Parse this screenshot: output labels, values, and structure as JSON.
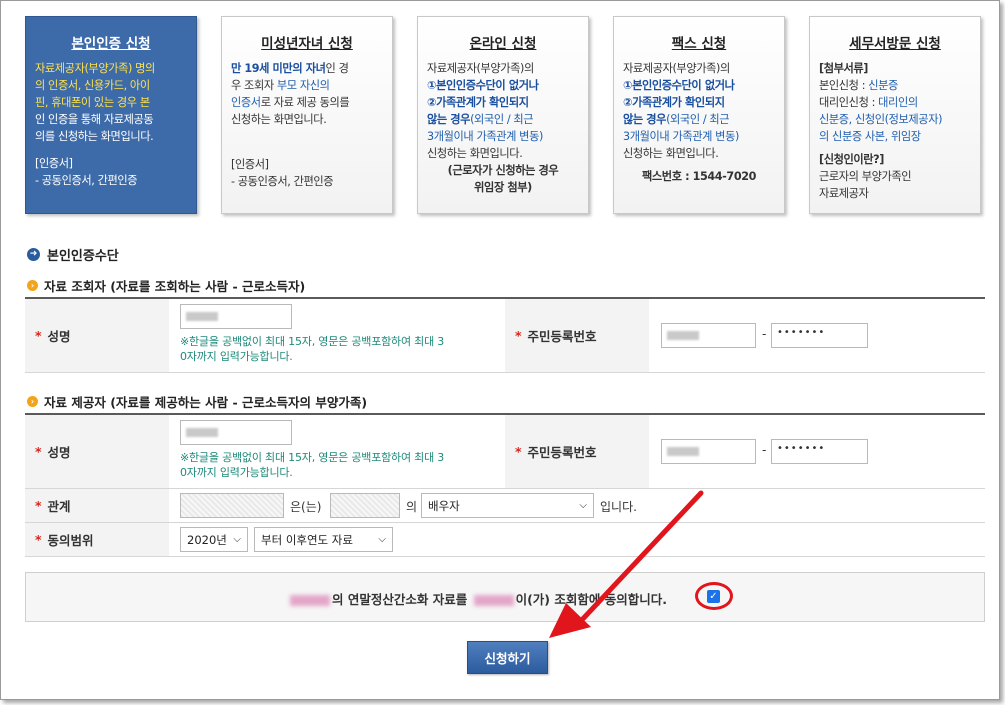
{
  "cards": [
    {
      "title": "본인인증 신청",
      "l1": "자료제공자(부양가족) 명의",
      "l2": "의 인증서, 신용카드, 아이",
      "l3": "핀,  휴대폰이 있는 경우 본",
      "l4": "인 인증을 통해 자료제공동",
      "l5": "의를 신청하는 화면입니다.",
      "cert_head": "[인증서]",
      "cert_body": "- 공동인증서, 간편인증"
    },
    {
      "title": "미성년자녀 신청",
      "l1a": "만 19세 미만의 자녀",
      "l1b": "인 경",
      "l2a": "우 조회자 ",
      "l2b": "부모 자신의",
      "l3a": "인증서",
      "l3b": "로 자료 제공 동의를",
      "l4": "신청하는 화면입니다.",
      "cert_head": "[인증서]",
      "cert_body": "- 공동인증서, 간편인증"
    },
    {
      "title": "온라인 신청",
      "l1": "자료제공자(부양가족)의",
      "l2": "①본인인증수단이 없거나",
      "l3": "②가족관계가 확인되지",
      "l4a": "않는 경우",
      "l4b": "(외국인 / 최근",
      "l5": "3개월이내 가족관계 변동)",
      "l6": "신청하는 화면입니다.",
      "l7": "(근로자가 신청하는 경우",
      "l8": "위임장 첨부)"
    },
    {
      "title": "팩스 신청",
      "l1": "자료제공자(부양가족)의",
      "l2": "①본인인증수단이 없거나",
      "l3": "②가족관계가 확인되지",
      "l4a": "않는 경우",
      "l4b": "(외국인 / 최근",
      "l5": "3개월이내 가족관계 변동)",
      "l6": "신청하는 화면입니다.",
      "fax": "팩스번호 : 1544-7020"
    },
    {
      "title": "세무서방문 신청",
      "docs_head": "[첨부서류]",
      "l1a": "본인신청 : ",
      "l1b": "신분증",
      "l2a": "대리인신청 : ",
      "l2b": "대리인의",
      "l3": "신분증, 신청인(정보제공자)",
      "l4": "의 신분증 사본, 위임장",
      "who_head": "[신청인이란?]",
      "l5": "근로자의 부양가족인",
      "l6": "자료제공자"
    }
  ],
  "section_main": "본인인증수단",
  "viewer_section": "자료 조회자 (자료를 조회하는 사람 - 근로소득자)",
  "provider_section": "자료 제공자 (자료를 제공하는 사람 - 근로소득자의 부양가족)",
  "labels": {
    "name": "성명",
    "rrn": "주민등록번호",
    "relation": "관계",
    "scope": "동의범위"
  },
  "note_line1": "※한글을 공백없이 최대 15자, 영문은 공백포함하여 최대 3",
  "note_line2": "0자까지 입력가능합니다.",
  "viewer": {
    "rrn_back": "•••••••"
  },
  "provider": {
    "rrn_back": "•••••••"
  },
  "dash": "-",
  "relation": {
    "eunneun": "은(는)",
    "ui": "의",
    "selected": "배우자",
    "suffix": "입니다."
  },
  "scope": {
    "year": "2020년",
    "range": "부터 이후연도 자료"
  },
  "agree": {
    "t1": "의 연말정산간소화 자료를",
    "t2": "이(가) 조회함에 동의합니다."
  },
  "submit_label": "신청하기"
}
